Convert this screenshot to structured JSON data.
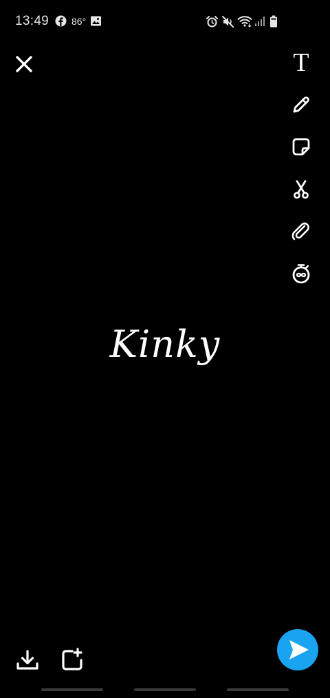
{
  "status_bar": {
    "time": "13:49",
    "temperature": "86°",
    "icons": [
      "facebook-icon",
      "image-icon",
      "alarm-icon",
      "mute-icon",
      "wifi-icon",
      "signal-icon",
      "battery-icon"
    ]
  },
  "editor": {
    "caption_text": "Kinky",
    "text_tool_glyph": "T",
    "tools": [
      "text-tool",
      "pencil-tool",
      "sticker-tool",
      "scissors-tool",
      "attachment-tool",
      "timer-tool"
    ]
  },
  "colors": {
    "background": "#000000",
    "foreground": "#ffffff",
    "send_button": "#1aa3f0"
  }
}
